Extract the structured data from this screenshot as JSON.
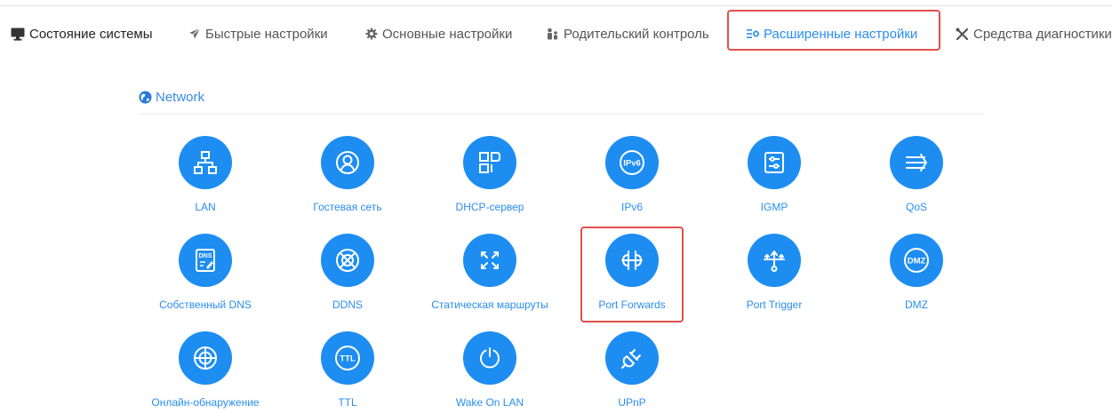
{
  "nav": {
    "items": [
      {
        "label": "Состояние системы",
        "icon": "monitor-icon"
      },
      {
        "label": "Быстрые настройки",
        "icon": "rocket-icon"
      },
      {
        "label": "Основные настройки",
        "icon": "gear-icon"
      },
      {
        "label": "Родительский контроль",
        "icon": "family-icon"
      },
      {
        "label": "Расширенные настройки",
        "icon": "advanced-settings-icon",
        "active": true
      },
      {
        "label": "Средства диагностики",
        "icon": "tools-icon"
      }
    ]
  },
  "section": {
    "title": "Network",
    "icon": "network-globe-icon"
  },
  "tiles": [
    {
      "label": "LAN",
      "icon": "lan-icon"
    },
    {
      "label": "Гостевая сеть",
      "icon": "guest-network-icon"
    },
    {
      "label": "DHCP-сервер",
      "icon": "dhcp-server-icon"
    },
    {
      "label": "IPv6",
      "icon": "ipv6-icon",
      "icon_text": "IPv6"
    },
    {
      "label": "IGMP",
      "icon": "igmp-icon"
    },
    {
      "label": "QoS",
      "icon": "qos-icon"
    },
    {
      "label": "Собственный DNS",
      "icon": "dns-icon",
      "icon_text": "DNS"
    },
    {
      "label": "DDNS",
      "icon": "ddns-icon"
    },
    {
      "label": "Статическая маршруты",
      "icon": "static-routes-icon"
    },
    {
      "label": "Port Forwards",
      "icon": "port-forwards-icon",
      "highlighted": true
    },
    {
      "label": "Port Trigger",
      "icon": "port-trigger-icon"
    },
    {
      "label": "DMZ",
      "icon": "dmz-icon",
      "icon_text": "DMZ"
    },
    {
      "label": "Онлайн-обнаружение",
      "icon": "online-detection-icon"
    },
    {
      "label": "TTL",
      "icon": "ttl-icon",
      "icon_text": "TTL"
    },
    {
      "label": "Wake On LAN",
      "icon": "wake-on-lan-icon"
    },
    {
      "label": "UPnP",
      "icon": "upnp-icon"
    }
  ],
  "colors": {
    "accent": "#1d8df2",
    "link": "#2a8ef0",
    "highlight": "#e0504d"
  }
}
